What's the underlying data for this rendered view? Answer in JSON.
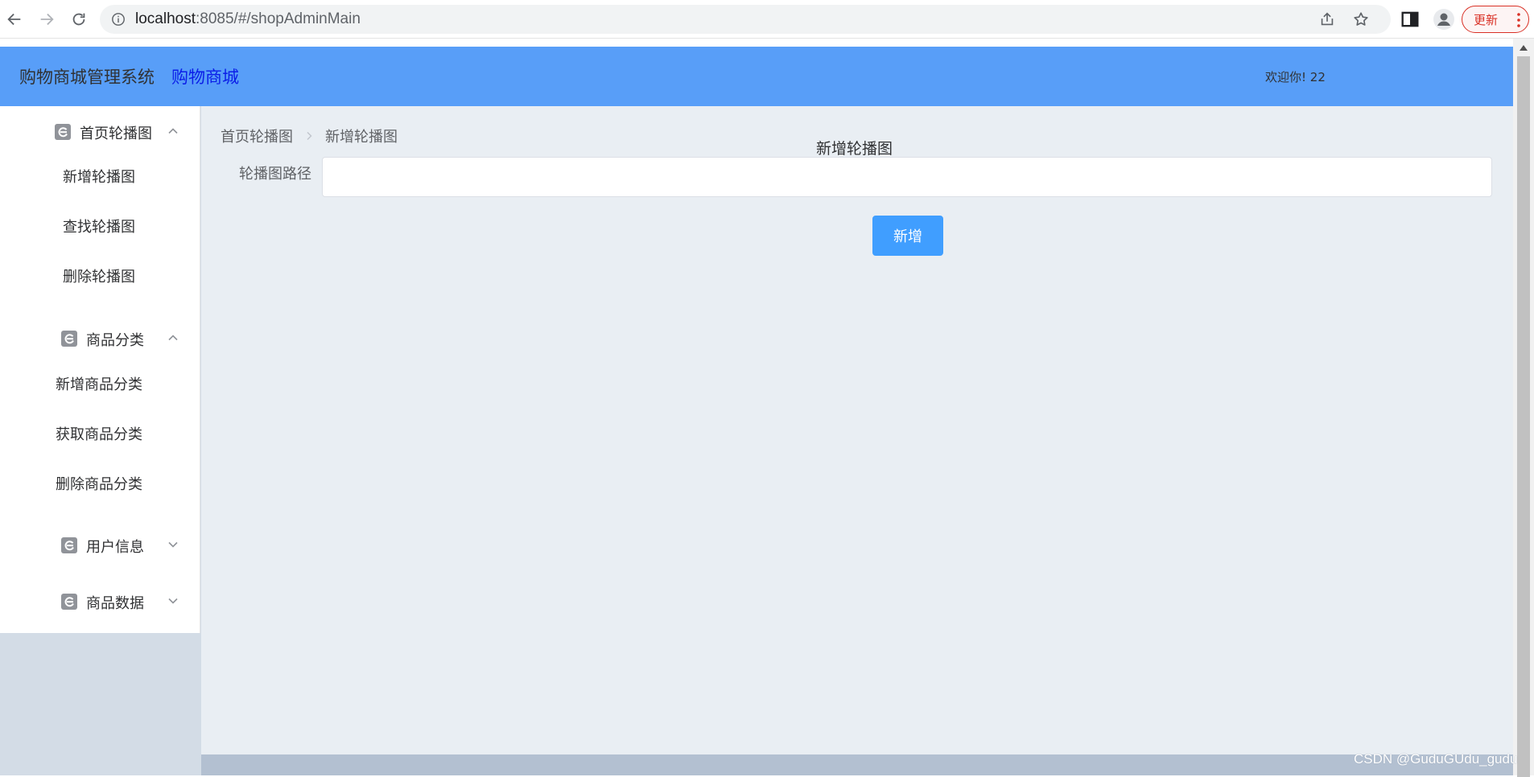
{
  "browser": {
    "url_host": "localhost",
    "url_rest": ":8085/#/shopAdminMain",
    "update_label": "更新"
  },
  "header": {
    "brand": "购物商城管理系统",
    "brand_link": "购物商城",
    "welcome": "欢迎你! 22"
  },
  "sidebar": {
    "groups": [
      {
        "title": "首页轮播图",
        "expanded": true,
        "items": [
          "新增轮播图",
          "查找轮播图",
          "删除轮播图"
        ]
      },
      {
        "title": "商品分类",
        "expanded": true,
        "items": [
          "新增商品分类",
          "获取商品分类",
          "删除商品分类"
        ]
      },
      {
        "title": "用户信息",
        "expanded": false,
        "items": []
      },
      {
        "title": "商品数据",
        "expanded": false,
        "items": []
      }
    ]
  },
  "main": {
    "breadcrumb": [
      "首页轮播图",
      "新增轮播图"
    ],
    "form_title": "新增轮播图",
    "field_label": "轮播图路径",
    "field_value": "",
    "submit_label": "新增"
  },
  "watermark": "CSDN @GuduGUdu_gudu",
  "colors": {
    "header": "#589ef8",
    "primary_button": "#409eff",
    "brand_link": "#0b1ee8",
    "update_red": "#d93025"
  }
}
